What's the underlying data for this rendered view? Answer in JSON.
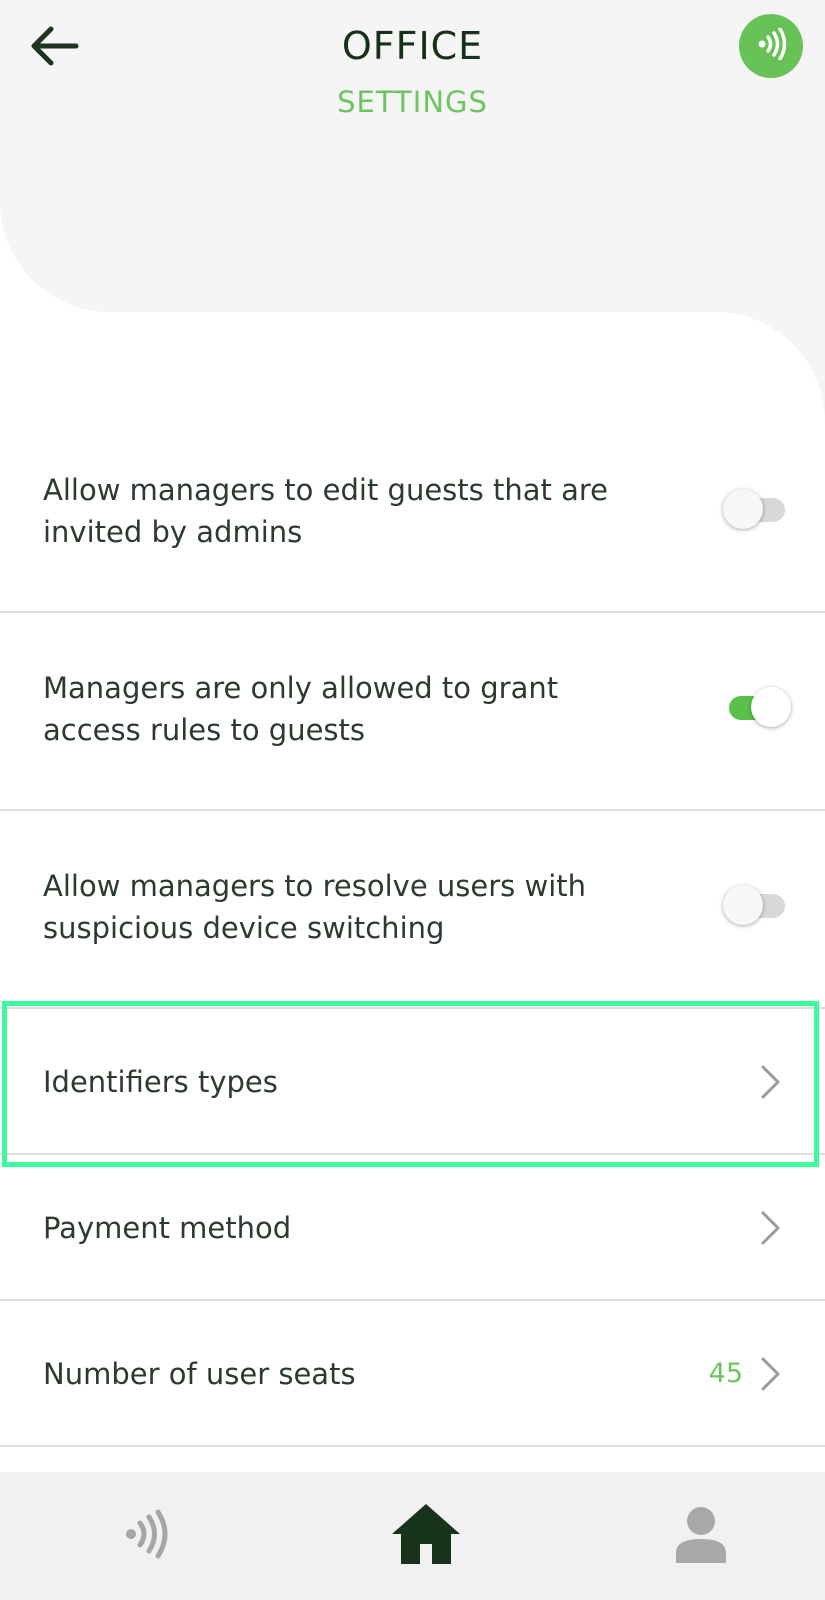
{
  "header": {
    "title": "OFFICE",
    "subtitle": "SETTINGS",
    "back_icon": "arrow-left-icon",
    "action_icon": "nfc-signal-icon"
  },
  "settings": {
    "toggles": [
      {
        "label": "Allow managers to edit guests that are invited by admins",
        "enabled": false
      },
      {
        "label": "Managers are only allowed to grant access rules to guests",
        "enabled": true
      },
      {
        "label": "Allow managers to resolve users with suspicious device switching",
        "enabled": false
      }
    ],
    "links": [
      {
        "label": "Identifiers types",
        "value": "",
        "highlighted": true
      },
      {
        "label": "Payment method",
        "value": ""
      },
      {
        "label": "Number of user seats",
        "value": "45"
      }
    ]
  },
  "bottom_nav": {
    "items": [
      {
        "icon": "nfc-signal-icon",
        "active": false
      },
      {
        "icon": "home-icon",
        "active": true
      },
      {
        "icon": "user-icon",
        "active": false
      }
    ]
  },
  "colors": {
    "accent": "#67c258",
    "title": "#173018",
    "highlight": "#3dfa9f",
    "header_bg": "#f5f5f5"
  }
}
